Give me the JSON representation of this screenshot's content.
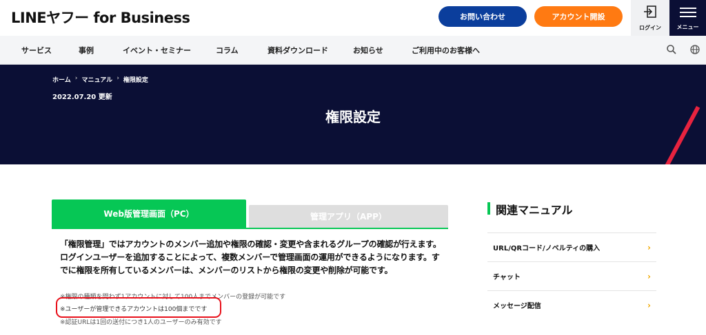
{
  "header": {
    "logo": "LINEヤフー for Business",
    "contact_label": "お問い合わせ",
    "account_label": "アカウント開設",
    "login_label": "ログイン",
    "menu_label": "メニュー"
  },
  "nav": {
    "items": [
      "サービス",
      "事例",
      "イベント・セミナー",
      "コラム",
      "資料ダウンロード",
      "お知らせ",
      "ご利用中のお客様へ"
    ]
  },
  "breadcrumb": [
    "ホーム",
    "マニュアル",
    "権限設定"
  ],
  "updated": "2022.07.20 更新",
  "page_title": "権限設定",
  "tabs": {
    "active": "Web版管理画面（PC）",
    "inactive": "管理アプリ（APP）"
  },
  "body_text": "「権限管理」ではアカウントのメンバー追加や権限の確認・変更や含まれるグループの確認が行えます。ログインユーザーを追加することによって、複数メンバーで管理画面の運用ができるようになります。すでに権限を所有しているメンバーは、メンバーのリストから権限の変更や削除が可能です。",
  "notes": [
    "※権限の種類を問わず1アカウントに対して100人までメンバーの登録が可能です",
    "※ユーザーが管理できるアカウントは100個までです",
    "※認証URLは1回の送付につき1人のユーザーのみ有効です"
  ],
  "sidebar": {
    "title": "関連マニュアル",
    "items": [
      "URL/QRコード/ノベルティの購入",
      "チャット",
      "メッセージ配信"
    ]
  },
  "colors": {
    "brand_green": "#06c755",
    "navy": "#0b0f35",
    "contact_blue": "#0b3e9c",
    "account_orange": "#ff7a12",
    "highlight_red": "#e8101a"
  }
}
